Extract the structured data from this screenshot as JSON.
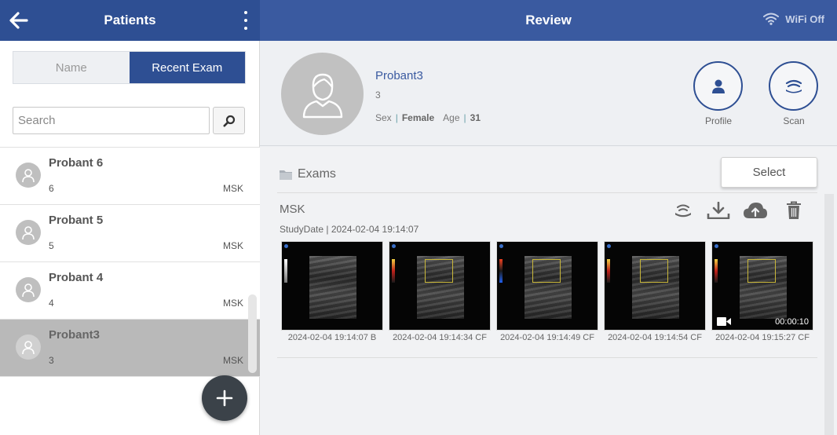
{
  "header": {
    "left_title": "Patients",
    "title": "Review",
    "wifi_label": "WiFi Off"
  },
  "left": {
    "tabs": [
      {
        "label": "Name"
      },
      {
        "label": "Recent Exam"
      }
    ],
    "search": {
      "placeholder": "Search"
    },
    "patients": [
      {
        "name": "Probant 6",
        "id": "6",
        "modality": "MSK",
        "selected": false
      },
      {
        "name": "Probant 5",
        "id": "5",
        "modality": "MSK",
        "selected": false
      },
      {
        "name": "Probant 4",
        "id": "4",
        "modality": "MSK",
        "selected": false
      },
      {
        "name": "Probant3",
        "id": "3",
        "modality": "MSK",
        "selected": true
      }
    ]
  },
  "profile": {
    "name": "Probant3",
    "id": "3",
    "sex_label": "Sex",
    "sex_value": "Female",
    "age_label": "Age",
    "age_value": "31",
    "profile_label": "Profile",
    "scan_label": "Scan"
  },
  "exams": {
    "title": "Exams",
    "select_label": "Select",
    "modality": "MSK",
    "study_date": "StudyDate | 2024-02-04 19:14:07",
    "images": [
      {
        "caption": "2024-02-04 19:14:07 B"
      },
      {
        "caption": "2024-02-04 19:14:34 CF"
      },
      {
        "caption": "2024-02-04 19:14:49 CF"
      },
      {
        "caption": "2024-02-04 19:14:54 CF"
      },
      {
        "caption": "2024-02-04 19:15:27 CF",
        "duration": "00:00:10"
      }
    ]
  },
  "colors": {
    "header_left": "#2e4f93",
    "header_right": "#3a5aa0",
    "accent": "#2e4f93",
    "selected_row": "#b9b9b9"
  }
}
